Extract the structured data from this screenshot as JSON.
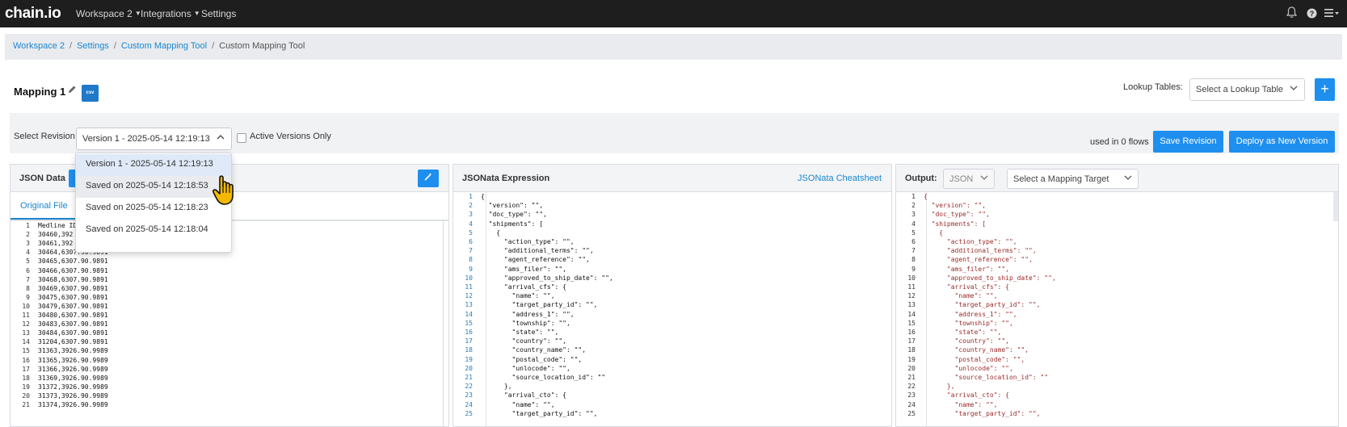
{
  "nav": {
    "logo": "chain.io",
    "workspace": "Workspace 2",
    "integrations": "Integrations",
    "settings": "Settings",
    "icons": [
      "bell-icon",
      "help-icon",
      "menu-icon"
    ]
  },
  "breadcrumb": {
    "items": [
      "Workspace 2",
      "Settings",
      "Custom Mapping Tool",
      "Custom Mapping Tool"
    ]
  },
  "header": {
    "title": "Mapping 1",
    "badge": "csv",
    "lookup_label": "Lookup Tables:",
    "lookup_placeholder": "Select a Lookup Table",
    "plus": "+"
  },
  "revision": {
    "label": "Select Revision",
    "selected": "Version 1 - 2025-05-14 12:19:13",
    "active_only_label": "Active Versions Only",
    "used_in": "used in 0 flows",
    "save_label": "Save Revision",
    "deploy_label": "Deploy as New Version",
    "options": [
      "Version 1 - 2025-05-14 12:19:13",
      "Saved on 2025-05-14 12:18:53",
      "Saved on 2025-05-14 12:18:23",
      "Saved on 2025-05-14 12:18:04"
    ]
  },
  "json_panel": {
    "title": "JSON Data",
    "tab": "Original File",
    "lines": [
      "Medline ID",
      "30460,392",
      "30461,392",
      "30464,6307.90.9891",
      "30465,6307.90.9891",
      "30466,6307.90.9891",
      "30468,6307.90.9891",
      "30469,6307.90.9891",
      "30475,6307.90.9891",
      "30479,6307.90.9891",
      "30480,6307.90.9891",
      "30483,6307.90.9891",
      "30484,6307.90.9891",
      "31204,6307.90.9891",
      "31363,3926.90.9989",
      "31365,3926.90.9989",
      "31366,3926.90.9989",
      "31369,3926.90.9989",
      "31372,3926.90.9989",
      "31373,3926.90.9989",
      "31374,3926.90.9989"
    ]
  },
  "expr_panel": {
    "title": "JSONata Expression",
    "cheatsheet": "JSONata Cheatsheet",
    "lines": [
      "{",
      "  \"version\": \"\",",
      "  \"doc_type\": \"\",",
      "  \"shipments\": [",
      "    {",
      "      \"action_type\": \"\",",
      "      \"additional_terms\": \"\",",
      "      \"agent_reference\": \"\",",
      "      \"ams_filer\": \"\",",
      "      \"approved_to_ship_date\": \"\",",
      "      \"arrival_cfs\": {",
      "        \"name\": \"\",",
      "        \"target_party_id\": \"\",",
      "        \"address_1\": \"\",",
      "        \"township\": \"\",",
      "        \"state\": \"\",",
      "        \"country\": \"\",",
      "        \"country_name\": \"\",",
      "        \"postal_code\": \"\",",
      "        \"unlocode\": \"\",",
      "        \"source_location_id\": \"\"",
      "      },",
      "      \"arrival_cto\": {",
      "        \"name\": \"\",",
      "        \"target_party_id\": \"\","
    ]
  },
  "output_panel": {
    "title": "Output:",
    "format": "JSON",
    "target_placeholder": "Select a Mapping Target",
    "lines": [
      "{",
      "  \"version\": \"\",",
      "  \"doc_type\": \"\",",
      "  \"shipments\": [",
      "    {",
      "      \"action_type\": \"\",",
      "      \"additional_terms\": \"\",",
      "      \"agent_reference\": \"\",",
      "      \"ams_filer\": \"\",",
      "      \"approved_to_ship_date\": \"\",",
      "      \"arrival_cfs\": {",
      "        \"name\": \"\",",
      "        \"target_party_id\": \"\",",
      "        \"address_1\": \"\",",
      "        \"township\": \"\",",
      "        \"state\": \"\",",
      "        \"country\": \"\",",
      "        \"country_name\": \"\",",
      "        \"postal_code\": \"\",",
      "        \"unlocode\": \"\",",
      "        \"source_location_id\": \"\"",
      "      },",
      "      \"arrival_cto\": {",
      "        \"name\": \"\",",
      "        \"target_party_id\": \"\","
    ]
  },
  "colors": {
    "accent": "#1e8fef",
    "link": "#1a86d0",
    "topbar": "#1e1e1e"
  }
}
